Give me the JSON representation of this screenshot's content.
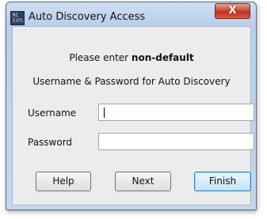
{
  "window": {
    "title": "Auto Discovery Access",
    "icon_line1": "RC",
    "icon_line2": "EXPL",
    "close_label": "X"
  },
  "prompt": {
    "line1_prefix": "Please enter",
    "line1_emphasis": "non-default",
    "line2": "Username & Password for Auto Discovery"
  },
  "form": {
    "username_label": "Username",
    "username_value": "",
    "password_label": "Password",
    "password_value": ""
  },
  "buttons": {
    "help": "Help",
    "next": "Next",
    "finish": "Finish"
  },
  "colors": {
    "title_bar": "#c3d7ee",
    "close_button": "#cf4b35",
    "dialog_background": "#ececec",
    "default_button_border": "#3c7fb1"
  }
}
